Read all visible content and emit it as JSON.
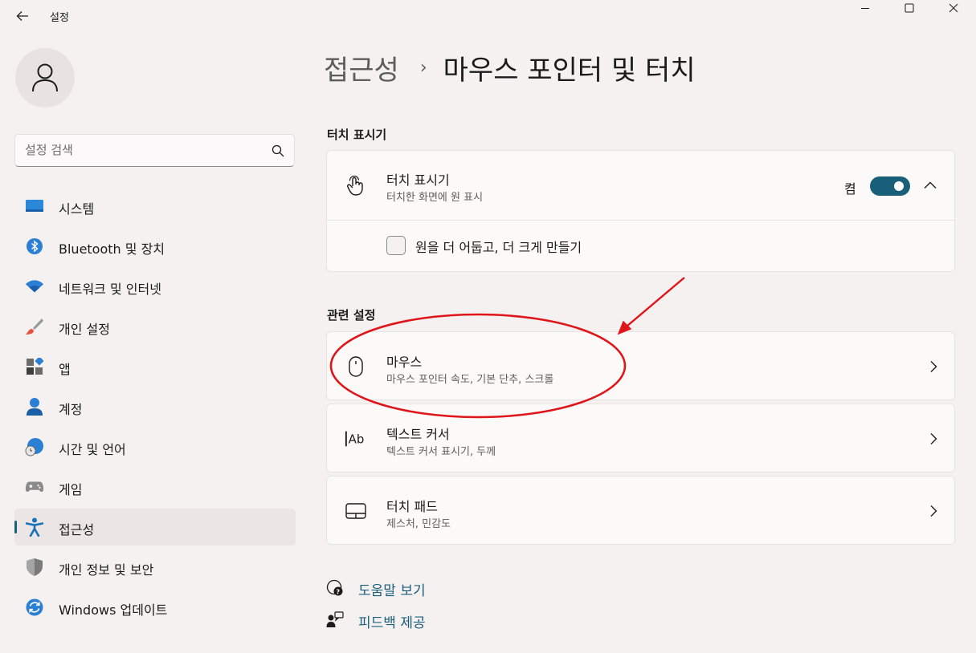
{
  "window": {
    "app_title": "설정"
  },
  "search": {
    "placeholder": "설정 검색"
  },
  "sidebar": {
    "items": [
      {
        "label": "시스템",
        "icon": "monitor-icon"
      },
      {
        "label": "Bluetooth 및 장치",
        "icon": "bluetooth-icon"
      },
      {
        "label": "네트워크 및 인터넷",
        "icon": "wifi-icon"
      },
      {
        "label": "개인 설정",
        "icon": "brush-icon"
      },
      {
        "label": "앱",
        "icon": "apps-icon"
      },
      {
        "label": "계정",
        "icon": "person-icon"
      },
      {
        "label": "시간 및 언어",
        "icon": "globe-clock-icon"
      },
      {
        "label": "게임",
        "icon": "gamepad-icon"
      },
      {
        "label": "접근성",
        "icon": "accessibility-icon",
        "active": true
      },
      {
        "label": "개인 정보 및 보안",
        "icon": "shield-icon"
      },
      {
        "label": "Windows 업데이트",
        "icon": "update-icon"
      }
    ]
  },
  "breadcrumb": {
    "parent": "접근성",
    "separator": "›",
    "current": "마우스 포인터 및 터치"
  },
  "touch_indicator_section": {
    "title": "터치 표시기",
    "card": {
      "title": "터치 표시기",
      "subtitle": "터치한 화면에 원 표시",
      "toggle_state_label": "켬",
      "toggle_on": true,
      "checkbox_label": "원을 더 어둡고, 더 크게 만들기",
      "checkbox_checked": false
    }
  },
  "related_section": {
    "title": "관련 설정",
    "cards": [
      {
        "title": "마우스",
        "subtitle": "마우스 포인터 속도, 기본 단추, 스크롤",
        "icon": "mouse-icon"
      },
      {
        "title": "텍스트 커서",
        "subtitle": "텍스트 커서 표시기, 두께",
        "icon": "text-cursor-icon"
      },
      {
        "title": "터치 패드",
        "subtitle": "제스처, 민감도",
        "icon": "touchpad-icon"
      }
    ]
  },
  "links": {
    "help": "도움말 보기",
    "feedback": "피드백 제공"
  },
  "colors": {
    "accent": "#1a5f7a",
    "annotation": "#e0151a",
    "background": "#f5f1f0"
  }
}
